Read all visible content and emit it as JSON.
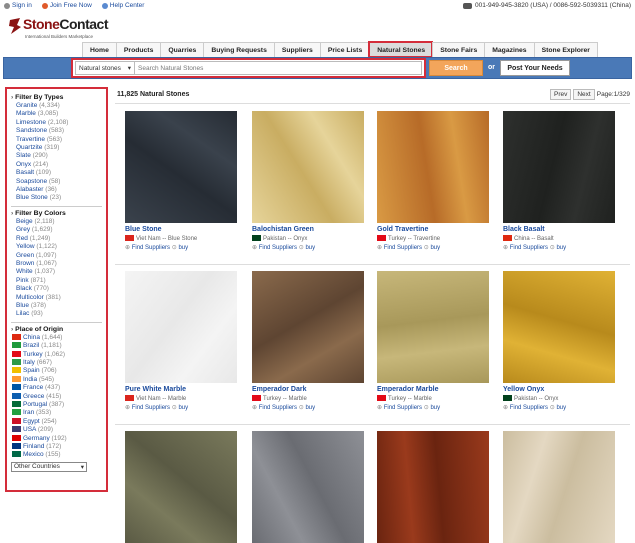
{
  "topbar": {
    "sign_in": "Sign in",
    "join": "Join Free Now",
    "help": "Help Center",
    "phone": "001-949-945-3820 (USA) / 0086-592-5039311 (China)"
  },
  "logo": {
    "brand_a": "Stone",
    "brand_b": "Contact",
    "tagline": "International Builders Marketplace"
  },
  "nav": {
    "tabs": [
      {
        "label": "Home"
      },
      {
        "label": "Products"
      },
      {
        "label": "Quarries"
      },
      {
        "label": "Buying Requests"
      },
      {
        "label": "Suppliers"
      },
      {
        "label": "Price Lists"
      },
      {
        "label": "Natural Stones"
      },
      {
        "label": "Stone Fairs"
      },
      {
        "label": "Magazines"
      },
      {
        "label": "Stone Explorer"
      }
    ],
    "active": "Natural Stones"
  },
  "search": {
    "category": "Natural stones",
    "placeholder": "Search Natural Stones",
    "search_label": "Search",
    "or_label": "or",
    "post_label": "Post Your Needs"
  },
  "sidebar": {
    "types_title": "Filter By Types",
    "types": [
      {
        "name": "Granite",
        "count": "(4,334)"
      },
      {
        "name": "Marble",
        "count": "(3,085)"
      },
      {
        "name": "Limestone",
        "count": "(2,108)"
      },
      {
        "name": "Sandstone",
        "count": "(583)"
      },
      {
        "name": "Travertine",
        "count": "(563)"
      },
      {
        "name": "Quartzite",
        "count": "(319)"
      },
      {
        "name": "Slate",
        "count": "(290)"
      },
      {
        "name": "Onyx",
        "count": "(214)"
      },
      {
        "name": "Basalt",
        "count": "(109)"
      },
      {
        "name": "Soapstone",
        "count": "(58)"
      },
      {
        "name": "Alabaster",
        "count": "(36)"
      },
      {
        "name": "Blue Stone",
        "count": "(23)"
      }
    ],
    "colors_title": "Filter By Colors",
    "colors": [
      {
        "name": "Beige",
        "count": "(2,118)"
      },
      {
        "name": "Grey",
        "count": "(1,629)"
      },
      {
        "name": "Red",
        "count": "(1,249)"
      },
      {
        "name": "Yellow",
        "count": "(1,122)"
      },
      {
        "name": "Green",
        "count": "(1,097)"
      },
      {
        "name": "Brown",
        "count": "(1,067)"
      },
      {
        "name": "White",
        "count": "(1,037)"
      },
      {
        "name": "Pink",
        "count": "(871)"
      },
      {
        "name": "Black",
        "count": "(770)"
      },
      {
        "name": "Multicolor",
        "count": "(381)"
      },
      {
        "name": "Blue",
        "count": "(378)"
      },
      {
        "name": "Lilac",
        "count": "(93)"
      }
    ],
    "origin_title": "Place of Origin",
    "origins": [
      {
        "name": "China",
        "count": "(1,644)",
        "flag": "#de2910"
      },
      {
        "name": "Brazil",
        "count": "(1,181)",
        "flag": "#1e9a3c"
      },
      {
        "name": "Turkey",
        "count": "(1,062)",
        "flag": "#e30a17"
      },
      {
        "name": "Italy",
        "count": "(667)",
        "flag": "#2e9a47"
      },
      {
        "name": "Spain",
        "count": "(706)",
        "flag": "#f1bf00"
      },
      {
        "name": "India",
        "count": "(545)",
        "flag": "#ff9933"
      },
      {
        "name": "France",
        "count": "(437)",
        "flag": "#0055a4"
      },
      {
        "name": "Greece",
        "count": "(415)",
        "flag": "#0d5eaf"
      },
      {
        "name": "Portugal",
        "count": "(387)",
        "flag": "#046a38"
      },
      {
        "name": "Iran",
        "count": "(353)",
        "flag": "#239f40"
      },
      {
        "name": "Egypt",
        "count": "(254)",
        "flag": "#ce1126"
      },
      {
        "name": "USA",
        "count": "(209)",
        "flag": "#3c3b6e"
      },
      {
        "name": "Germany",
        "count": "(192)",
        "flag": "#dd0000"
      },
      {
        "name": "Finland",
        "count": "(172)",
        "flag": "#003580"
      },
      {
        "name": "Mexico",
        "count": "(155)",
        "flag": "#006847"
      }
    ],
    "other_select": "Other Countries"
  },
  "content": {
    "count_label": "11,825 Natural Stones",
    "prev": "Prev",
    "next": "Next",
    "page": "Page:1/329",
    "find_label": "Find Suppliers",
    "buy_label": "buy",
    "cards": [
      {
        "name": "Blue Stone",
        "origin": "Viet Nam -- Blue Stone",
        "flag": "#da251d",
        "c1": "#3a424c",
        "c2": "#262c34"
      },
      {
        "name": "Balochistan Green",
        "origin": "Pakistan -- Onyx",
        "flag": "#01411c",
        "c1": "#e6d49a",
        "c2": "#c9ad62"
      },
      {
        "name": "Gold Travertine",
        "origin": "Turkey -- Travertine",
        "flag": "#e30a17",
        "c1": "#d99a44",
        "c2": "#b76b28"
      },
      {
        "name": "Black Basalt",
        "origin": "China -- Basalt",
        "flag": "#de2910",
        "c1": "#2e302e",
        "c2": "#1f211f"
      },
      {
        "name": "Pure White Marble",
        "origin": "Viet Nam -- Marble",
        "flag": "#da251d",
        "c1": "#f4f4f4",
        "c2": "#e8e8e8"
      },
      {
        "name": "Emperador Dark",
        "origin": "Turkey -- Marble",
        "flag": "#e30a17",
        "c1": "#8a6a4c",
        "c2": "#5e4532"
      },
      {
        "name": "Emperador Marble",
        "origin": "Turkey -- Marble",
        "flag": "#e30a17",
        "c1": "#c7b77a",
        "c2": "#a8985a"
      },
      {
        "name": "Yellow Onyx",
        "origin": "Pakistan -- Onyx",
        "flag": "#01411c",
        "c1": "#e0b235",
        "c2": "#b88a1c"
      },
      {
        "name": "",
        "origin": "",
        "flag": "",
        "c1": "#7a7a5c",
        "c2": "#5a5a44"
      },
      {
        "name": "",
        "origin": "",
        "flag": "",
        "c1": "#8e9096",
        "c2": "#6a6c72"
      },
      {
        "name": "",
        "origin": "",
        "flag": "",
        "c1": "#9a3a1c",
        "c2": "#6a2410"
      },
      {
        "name": "",
        "origin": "",
        "flag": "",
        "c1": "#e4d8c2",
        "c2": "#cbbd9f"
      }
    ]
  }
}
